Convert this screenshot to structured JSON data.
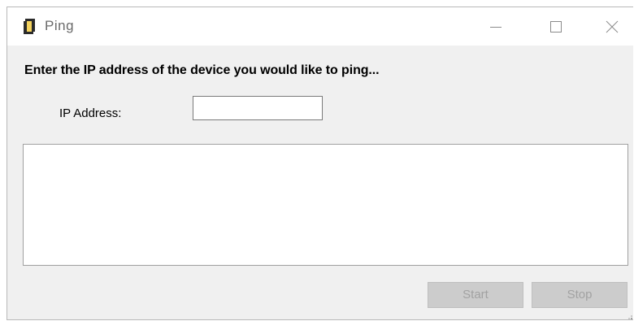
{
  "window": {
    "title": "Ping",
    "icon": "ping-app-icon",
    "controls": {
      "minimize_icon": "minimize-icon",
      "maximize_icon": "maximize-icon",
      "close_icon": "close-icon"
    }
  },
  "form": {
    "prompt": "Enter the IP address of the device you would like to ping...",
    "ip_label": "IP Address:",
    "ip_value": "",
    "output_text": ""
  },
  "buttons": {
    "start_label": "Start",
    "stop_label": "Stop",
    "start_enabled": false,
    "stop_enabled": false
  }
}
